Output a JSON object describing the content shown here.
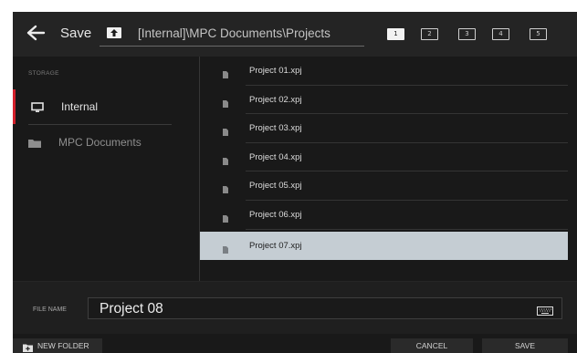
{
  "header": {
    "back_icon": "arrow-left-icon",
    "title": "Save",
    "up_icon": "folder-up-icon",
    "path": "[Internal]\\MPC Documents\\Projects",
    "slots": [
      {
        "label": "1",
        "active": true
      },
      {
        "label": "2",
        "active": false
      },
      {
        "label": "3",
        "active": false
      },
      {
        "label": "4",
        "active": false
      },
      {
        "label": "5",
        "active": false
      }
    ]
  },
  "sidebar": {
    "heading": "STORAGE",
    "items": [
      {
        "label": "Internal",
        "icon": "monitor-icon",
        "selected": true
      },
      {
        "label": "MPC Documents",
        "icon": "folder-icon",
        "selected": false
      }
    ]
  },
  "files": {
    "items": [
      {
        "name": "Project 01.xpj",
        "selected": false
      },
      {
        "name": "Project 02.xpj",
        "selected": false
      },
      {
        "name": "Project 03.xpj",
        "selected": false
      },
      {
        "name": "Project 04.xpj",
        "selected": false
      },
      {
        "name": "Project 05.xpj",
        "selected": false
      },
      {
        "name": "Project 06.xpj",
        "selected": false
      },
      {
        "name": "Project 07.xpj",
        "selected": true
      }
    ]
  },
  "filename": {
    "label": "FILE NAME",
    "value": "Project 08",
    "keyboard_icon": "keyboard-icon"
  },
  "footer": {
    "new_folder": "NEW FOLDER",
    "cancel": "CANCEL",
    "save": "SAVE"
  },
  "colors": {
    "accent": "#d3202b",
    "selected_row": "#c5cdd3",
    "background": "#191919"
  }
}
